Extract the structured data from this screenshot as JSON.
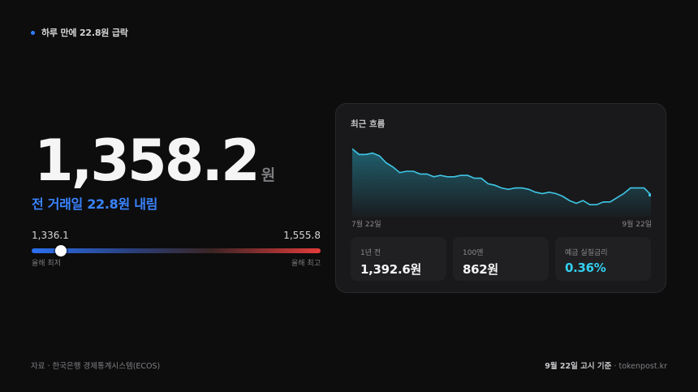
{
  "header": {
    "badge": "하루 만에 22.8원 급락",
    "accent": "#2f7dff"
  },
  "price": {
    "value": "1,358.2",
    "unit": "원"
  },
  "change": {
    "text": "전 거래일 22.8원 내림",
    "color": "#3a84ff"
  },
  "range": {
    "low_value": "1,336.1",
    "high_value": "1,555.8",
    "low_label": "올해 최저",
    "high_label": "올해 최고",
    "current_fraction": 0.1
  },
  "card": {
    "title": "최근 흐름",
    "x_start": "7월 22일",
    "x_end": "9월 22일",
    "stats": [
      {
        "label": "1년 전",
        "value": "1,392.6원"
      },
      {
        "label": "100엔",
        "value": "862원"
      },
      {
        "label": "예금 실질금리",
        "value": "0.36%",
        "accent": "#33d0f0"
      }
    ]
  },
  "chart_data": {
    "type": "area",
    "title": "최근 흐름",
    "x_start": "7월 22일",
    "x_end": "9월 22일",
    "color": "#3fc6e6",
    "values": [
      1392,
      1388,
      1388,
      1389,
      1387,
      1382,
      1379,
      1375,
      1376,
      1376,
      1374,
      1374,
      1372,
      1373,
      1372,
      1372,
      1373,
      1373,
      1371,
      1371,
      1367,
      1366,
      1364,
      1363,
      1364,
      1364,
      1363,
      1361,
      1360,
      1361,
      1360,
      1358,
      1355,
      1353,
      1355,
      1352,
      1352,
      1354,
      1354,
      1357,
      1360,
      1364,
      1364,
      1364,
      1359
    ]
  },
  "footer": {
    "source": "자료 · 한국은행 경제통계시스템(ECOS)",
    "date_label": "9월 22일 고시 기준",
    "site": " · tokenpost.kr"
  }
}
